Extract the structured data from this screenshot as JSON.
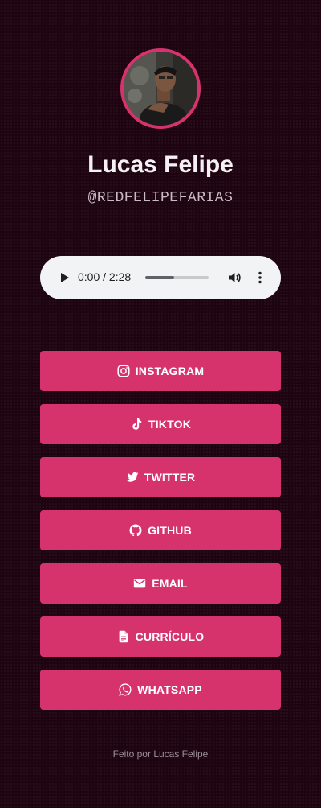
{
  "profile": {
    "name": "Lucas Felipe",
    "handle": "@REDFELIPEFARIAS",
    "avatar_alt": "profile photo"
  },
  "audio": {
    "time": "0:00 / 2:28",
    "progress_fraction": 0.0,
    "buffered_fraction": 0.45,
    "play_icon": "play-icon",
    "volume_icon": "volume-icon",
    "more_icon": "more-vertical-icon"
  },
  "links": [
    {
      "label": "INSTAGRAM",
      "icon": "instagram-icon"
    },
    {
      "label": "TIKTOK",
      "icon": "tiktok-icon"
    },
    {
      "label": "TWITTER",
      "icon": "twitter-icon"
    },
    {
      "label": "GITHUB",
      "icon": "github-icon"
    },
    {
      "label": "EMAIL",
      "icon": "email-icon"
    },
    {
      "label": "CURRÍCULO",
      "icon": "document-icon"
    },
    {
      "label": "WHATSAPP",
      "icon": "whatsapp-icon"
    }
  ],
  "footer": {
    "text": "Feito por Lucas Felipe"
  },
  "colors": {
    "background": "#1d0410",
    "accent": "#d6336c",
    "player_bg": "#f1f3f4"
  }
}
